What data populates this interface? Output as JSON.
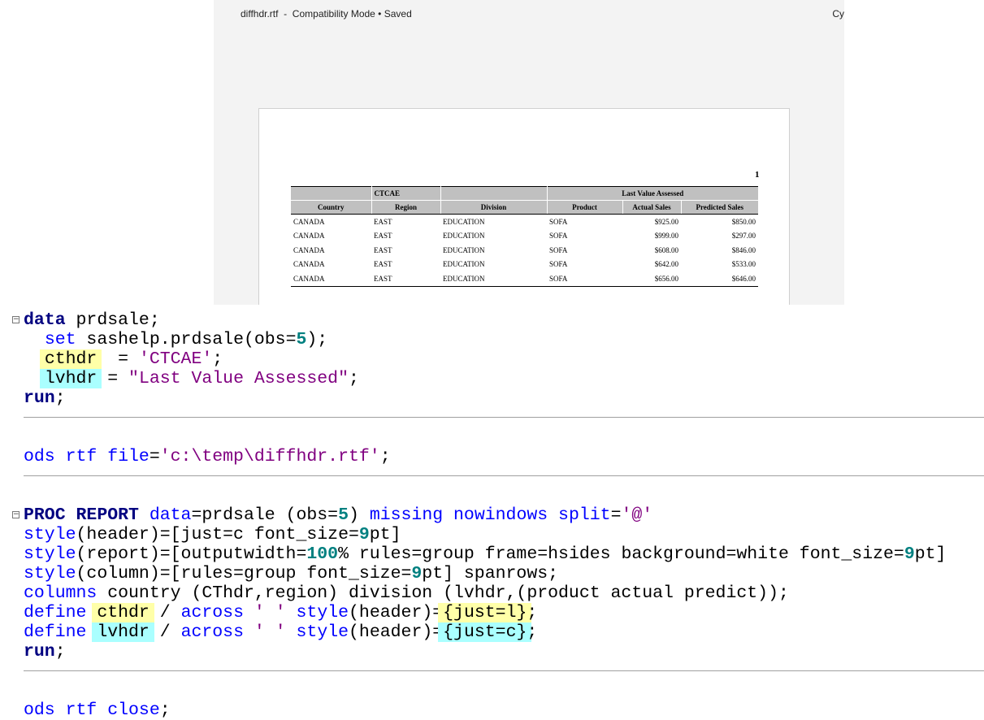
{
  "window": {
    "title": "diffhdr.rtf  -  Compatibility Mode • Saved",
    "user_initials": "Cy"
  },
  "report": {
    "page_number": "1",
    "spanning_headers": [
      "",
      "CTCAE",
      "",
      "Last Value Assessed"
    ],
    "columns": [
      "Country",
      "Region",
      "Division",
      "Product",
      "Actual Sales",
      "Predicted Sales"
    ],
    "rows": [
      [
        "CANADA",
        "EAST",
        "EDUCATION",
        "SOFA",
        "$925.00",
        "$850.00"
      ],
      [
        "CANADA",
        "EAST",
        "EDUCATION",
        "SOFA",
        "$999.00",
        "$297.00"
      ],
      [
        "CANADA",
        "EAST",
        "EDUCATION",
        "SOFA",
        "$608.00",
        "$846.00"
      ],
      [
        "CANADA",
        "EAST",
        "EDUCATION",
        "SOFA",
        "$642.00",
        "$533.00"
      ],
      [
        "CANADA",
        "EAST",
        "EDUCATION",
        "SOFA",
        "$656.00",
        "$646.00"
      ]
    ]
  },
  "code": [
    {
      "fold": true,
      "tokens": [
        [
          "kw",
          "data"
        ],
        [
          "plain",
          " prdsale;"
        ]
      ]
    },
    {
      "tokens": [
        [
          "plain",
          "  "
        ],
        [
          "blue",
          "set"
        ],
        [
          "plain",
          " sashelp.prdsale(obs="
        ],
        [
          "num",
          "5"
        ],
        [
          "plain",
          ");"
        ]
      ]
    },
    {
      "tokens": [
        [
          "plain",
          "  "
        ],
        [
          "hy",
          "cthdr"
        ],
        [
          "plain",
          "  = "
        ],
        [
          "str",
          "'CTCAE'"
        ],
        [
          "plain",
          ";"
        ]
      ]
    },
    {
      "tokens": [
        [
          "plain",
          "  "
        ],
        [
          "hc",
          "lvhdr"
        ],
        [
          "plain",
          " = "
        ],
        [
          "str",
          "\"Last Value Assessed\""
        ],
        [
          "plain",
          ";"
        ]
      ]
    },
    {
      "tokens": [
        [
          "kw",
          "run"
        ],
        [
          "plain",
          ";"
        ]
      ],
      "sep": true
    },
    {
      "blank": true
    },
    {
      "tokens": [
        [
          "blue",
          "ods rtf file"
        ],
        [
          "plain",
          "="
        ],
        [
          "str",
          "'c:\\temp\\diffhdr.rtf'"
        ],
        [
          "plain",
          ";"
        ]
      ],
      "sep": true
    },
    {
      "blank": true
    },
    {
      "fold": true,
      "tokens": [
        [
          "kw",
          "PROC REPORT"
        ],
        [
          "plain",
          " "
        ],
        [
          "blue",
          "data"
        ],
        [
          "plain",
          "=prdsale (obs="
        ],
        [
          "num",
          "5"
        ],
        [
          "plain",
          ") "
        ],
        [
          "blue",
          "missing nowindows split"
        ],
        [
          "plain",
          "="
        ],
        [
          "str",
          "'@'"
        ]
      ]
    },
    {
      "tokens": [
        [
          "blue",
          "style"
        ],
        [
          "plain",
          "(header)=[just=c font_size="
        ],
        [
          "num",
          "9"
        ],
        [
          "plain",
          "pt]"
        ]
      ]
    },
    {
      "tokens": [
        [
          "blue",
          "style"
        ],
        [
          "plain",
          "(report)=[outputwidth="
        ],
        [
          "num",
          "100"
        ],
        [
          "plain",
          "% rules=group frame=hsides background=white font_size="
        ],
        [
          "num",
          "9"
        ],
        [
          "plain",
          "pt]"
        ]
      ]
    },
    {
      "tokens": [
        [
          "blue",
          "style"
        ],
        [
          "plain",
          "(column)=[rules=group font_size="
        ],
        [
          "num",
          "9"
        ],
        [
          "plain",
          "pt] spanrows;"
        ]
      ]
    },
    {
      "tokens": [
        [
          "blue",
          "columns"
        ],
        [
          "plain",
          " country (CThdr,region) division (lvhdr,(product actual predict));"
        ]
      ]
    },
    {
      "tokens": [
        [
          "blue",
          "define"
        ],
        [
          "plain",
          " "
        ],
        [
          "hy",
          "cthdr"
        ],
        [
          "plain",
          " / "
        ],
        [
          "blue",
          "across"
        ],
        [
          "plain",
          " "
        ],
        [
          "str",
          "' '"
        ],
        [
          "plain",
          " "
        ],
        [
          "blue",
          "style"
        ],
        [
          "plain",
          "(header)="
        ],
        [
          "hy",
          "{just=l}"
        ],
        [
          "plain",
          ";"
        ]
      ]
    },
    {
      "tokens": [
        [
          "blue",
          "define"
        ],
        [
          "plain",
          " "
        ],
        [
          "hc",
          "lvhdr"
        ],
        [
          "plain",
          " / "
        ],
        [
          "blue",
          "across"
        ],
        [
          "plain",
          " "
        ],
        [
          "str",
          "' '"
        ],
        [
          "plain",
          " "
        ],
        [
          "blue",
          "style"
        ],
        [
          "plain",
          "(header)="
        ],
        [
          "hc",
          "{just=c}"
        ],
        [
          "plain",
          ";"
        ]
      ]
    },
    {
      "tokens": [
        [
          "kw",
          "run"
        ],
        [
          "plain",
          ";"
        ]
      ],
      "sep": true
    },
    {
      "blank": true
    },
    {
      "tokens": [
        [
          "blue",
          "ods rtf close"
        ],
        [
          "plain",
          ";"
        ]
      ]
    }
  ]
}
